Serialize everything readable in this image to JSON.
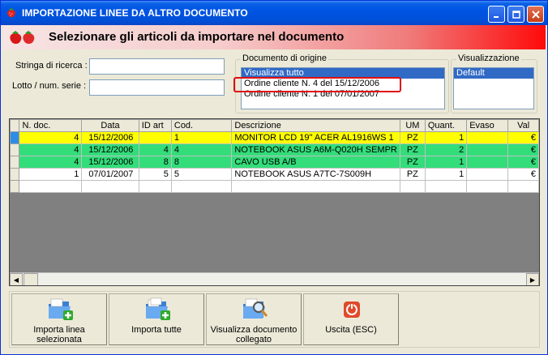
{
  "window": {
    "title": "IMPORTAZIONE LINEE DA ALTRO DOCUMENTO"
  },
  "header": {
    "title": "Selezionare gli articoli da importare nel documento"
  },
  "search": {
    "search_label": "Stringa di ricerca :",
    "search_value": "",
    "lot_label": "Lotto / num. serie :",
    "lot_value": ""
  },
  "origin": {
    "title": "Documento di origine",
    "items": [
      "Visualizza tutto",
      "Ordine cliente N. 4 del 15/12/2006",
      "Ordine cliente N. 1 del 07/01/2007"
    ],
    "selected_index": 0,
    "highlighted_index": 1
  },
  "view": {
    "title": "Visualizzazione",
    "items": [
      "Default"
    ],
    "selected_index": 0
  },
  "grid": {
    "columns": [
      "N. doc.",
      "Data",
      "ID art",
      "Cod.",
      "Descrizione",
      "UM",
      "Quant.",
      "Evaso",
      "Val"
    ],
    "rows": [
      {
        "ndoc": "4",
        "data": "15/12/2006",
        "idart": "",
        "cod": "1",
        "desc": "MONITOR LCD 19\" ACER AL1916WS 1",
        "um": "PZ",
        "quant": "1",
        "evaso": "",
        "val": "€"
      },
      {
        "ndoc": "4",
        "data": "15/12/2006",
        "idart": "4",
        "cod": "4",
        "desc": "NOTEBOOK ASUS A6M-Q020H SEMPR",
        "um": "PZ",
        "quant": "2",
        "evaso": "",
        "val": "€"
      },
      {
        "ndoc": "4",
        "data": "15/12/2006",
        "idart": "8",
        "cod": "8",
        "desc": "CAVO USB A/B",
        "um": "PZ",
        "quant": "1",
        "evaso": "",
        "val": "€"
      },
      {
        "ndoc": "1",
        "data": "07/01/2007",
        "idart": "5",
        "cod": "5",
        "desc": "NOTEBOOK ASUS A7TC-7S009H",
        "um": "PZ",
        "quant": "1",
        "evaso": "",
        "val": "€"
      }
    ],
    "row_colors": [
      "#ffff00",
      "#33dd7a",
      "#33dd7a",
      "#ffffff"
    ]
  },
  "buttons": {
    "import_selected": "Importa linea\nselezionata",
    "import_all": "Importa tutte",
    "view_doc": "Visualizza documento\ncollegato",
    "exit": "Uscita (ESC)"
  },
  "icons": {
    "app": "strawberry-icon",
    "header": "strawberries-icon",
    "import_selected": "folder-add-icon",
    "import_all": "folder-add-multiple-icon",
    "view_doc": "folder-search-icon",
    "exit": "power-off-icon"
  }
}
